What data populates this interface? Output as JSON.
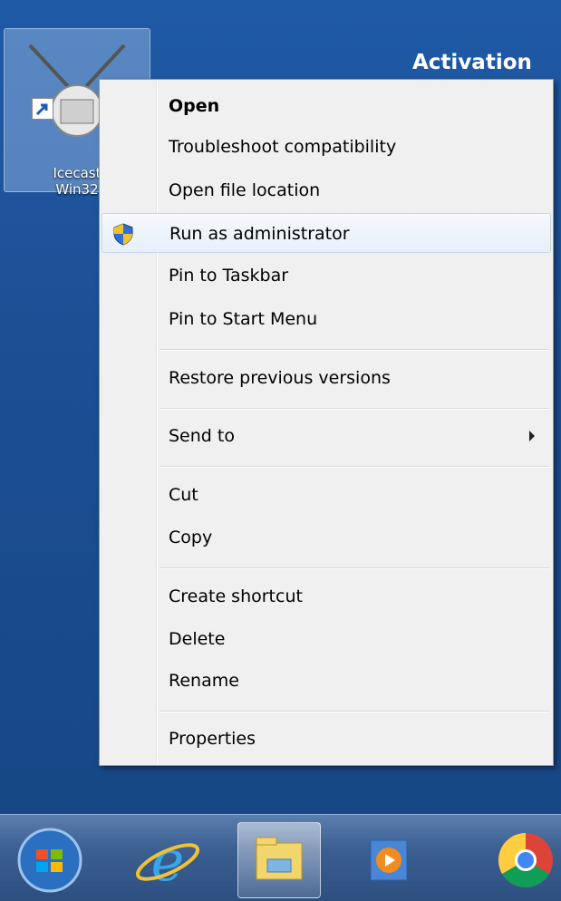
{
  "desktop": {
    "heading": "Activation",
    "shortcut": {
      "label_line1": "Icecast",
      "label_line2": "Win32",
      "icon": "icecast-antenna-icon"
    }
  },
  "context_menu": {
    "items": [
      {
        "label": "Open",
        "bold": true
      },
      {
        "label": "Troubleshoot compatibility"
      },
      {
        "label": "Open file location"
      },
      {
        "label": "Run as administrator",
        "icon": "uac-shield-icon",
        "hovered": true
      },
      {
        "label": "Pin to Taskbar"
      },
      {
        "label": "Pin to Start Menu"
      },
      {
        "label": "Restore previous versions"
      },
      {
        "label": "Send to",
        "submenu": true
      },
      {
        "label": "Cut"
      },
      {
        "label": "Copy"
      },
      {
        "label": "Create shortcut"
      },
      {
        "label": "Delete"
      },
      {
        "label": "Rename"
      },
      {
        "label": "Properties"
      }
    ]
  },
  "taskbar": {
    "buttons": [
      {
        "icon": "start-orb-icon"
      },
      {
        "icon": "internet-explorer-icon"
      },
      {
        "icon": "file-explorer-icon",
        "active": true
      },
      {
        "icon": "media-player-icon"
      },
      {
        "icon": "chrome-icon"
      }
    ]
  },
  "colors": {
    "desktop_bg": "#1b4f93",
    "menu_bg": "#f0f0f0",
    "hover_bg": "#e7eff9",
    "hover_border": "#c5d6ea"
  }
}
